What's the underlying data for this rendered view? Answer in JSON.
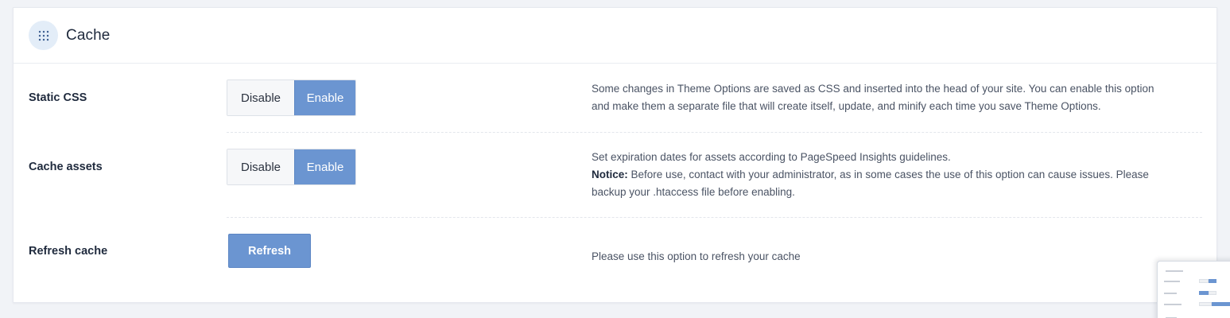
{
  "panel": {
    "title": "Cache",
    "icon": "grid-dots-icon"
  },
  "rows": [
    {
      "label": "Static CSS",
      "disable_label": "Disable",
      "enable_label": "Enable",
      "selected": "Enable",
      "description_line1": "Some changes in Theme Options are saved as CSS and inserted into the head of your site. You can enable this option",
      "description_line2": "and make them a separate file that will create itself, update, and minify each time you save Theme Options."
    },
    {
      "label": "Cache assets",
      "disable_label": "Disable",
      "enable_label": "Enable",
      "selected": "Enable",
      "description_line1": "Set expiration dates for assets according to PageSpeed Insights guidelines.",
      "notice_label": "Notice:",
      "notice_text": "Before use, contact with your administrator, as in some cases the use of this option can cause issues. Please",
      "description_line3": "backup your .htaccess file before enabling."
    },
    {
      "label": "Refresh cache",
      "button_label": "Refresh",
      "description": "Please use this option to refresh your cache"
    }
  ],
  "colors": {
    "accent": "#6b95d1",
    "background": "#f1f3f7",
    "panel": "#ffffff"
  }
}
